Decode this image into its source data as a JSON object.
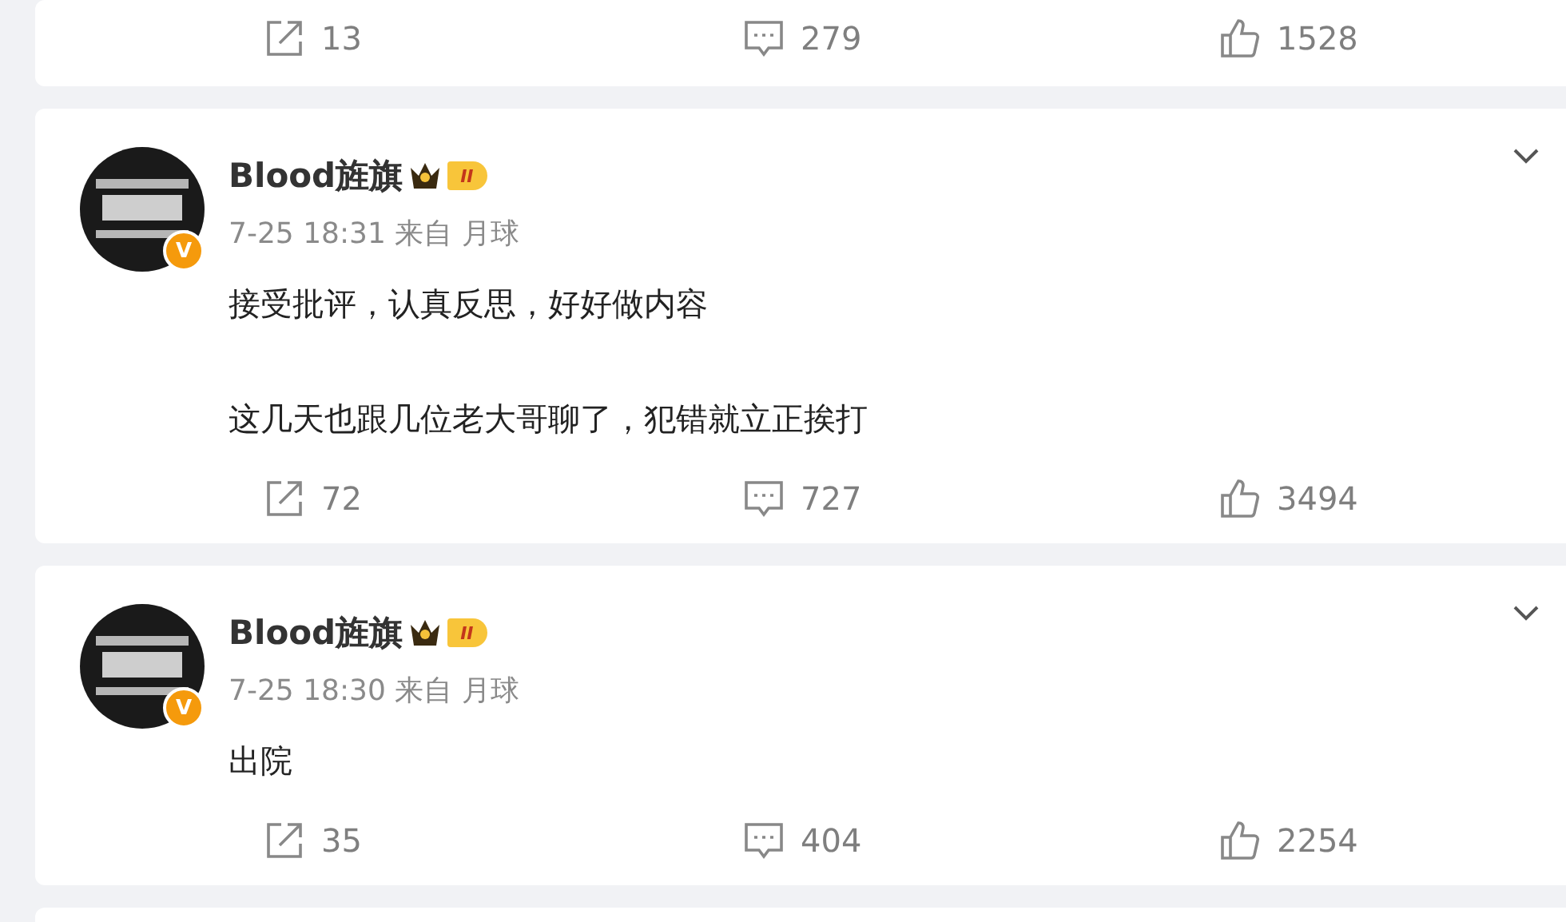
{
  "posts": [
    {
      "partial": true,
      "actions": [
        {
          "kind": "repost",
          "count": "13"
        },
        {
          "kind": "comment",
          "count": "279"
        },
        {
          "kind": "like",
          "count": "1528"
        }
      ]
    },
    {
      "partial": false,
      "author": "Blood旌旗",
      "verified_badge": "V",
      "level_badge": "II",
      "time": "7-25 18:31",
      "source": "来自 月球",
      "paragraphs": [
        "接受批评，认真反思，好好做内容",
        "这几天也跟几位老大哥聊了，犯错就立正挨打"
      ],
      "actions": [
        {
          "kind": "repost",
          "count": "72"
        },
        {
          "kind": "comment",
          "count": "727"
        },
        {
          "kind": "like",
          "count": "3494"
        }
      ]
    },
    {
      "partial": false,
      "author": "Blood旌旗",
      "verified_badge": "V",
      "level_badge": "II",
      "time": "7-25 18:30",
      "source": "来自 月球",
      "paragraphs": [
        "出院"
      ],
      "actions": [
        {
          "kind": "repost",
          "count": "35"
        },
        {
          "kind": "comment",
          "count": "404"
        },
        {
          "kind": "like",
          "count": "2254"
        }
      ]
    }
  ]
}
